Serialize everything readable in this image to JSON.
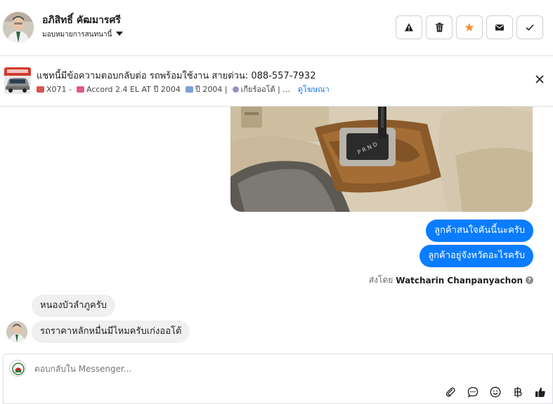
{
  "header": {
    "contact_name": "อภิสิทธิ์ คัฒมารศรี",
    "assign_label": "มอบหมายการสนทนานี้",
    "actions": [
      {
        "name": "report-spam-button",
        "icon": "warning-icon"
      },
      {
        "name": "delete-button",
        "icon": "trash-icon"
      },
      {
        "name": "star-button",
        "icon": "star-icon",
        "color": "#f7923a"
      },
      {
        "name": "mark-unread-button",
        "icon": "envelope-icon"
      },
      {
        "name": "mark-done-button",
        "icon": "check-icon"
      }
    ]
  },
  "banner": {
    "title": "แชทนี้มีข้อความตอบกลับต่อ รถพร้อมใช้งาน สายด่วน: 088-557-7932",
    "listing_id": "X071 -",
    "model": "Accord 2.4 EL AT ปี 2004",
    "year": "ปี 2004 |",
    "gear": "เกียร์ออโต้ | ...",
    "view_ad": "ดูโฆษณา"
  },
  "messages": {
    "outgoing": [
      "ลูกค้าสนใจคันนี้นะครับ",
      "ลูกค้าอยู่จังหวัดอะไรครับ"
    ],
    "sent_by_prefix": "ส่งโดย",
    "sent_by_name": "Watcharin Chanpanyachon",
    "incoming": [
      "หนองบัวลำภูครับ",
      "รถราคาหลักหมื่นมีไหมครับเก่งออโต้"
    ]
  },
  "composer": {
    "placeholder": "ตอบกลับใน Messenger...",
    "tools": [
      "paperclip-icon",
      "quick-reply-icon",
      "emoji-icon",
      "baht-icon",
      "thumbs-up-icon"
    ]
  },
  "colors": {
    "accent": "#0a7cff",
    "link": "#1877f2",
    "star": "#f7923a"
  }
}
